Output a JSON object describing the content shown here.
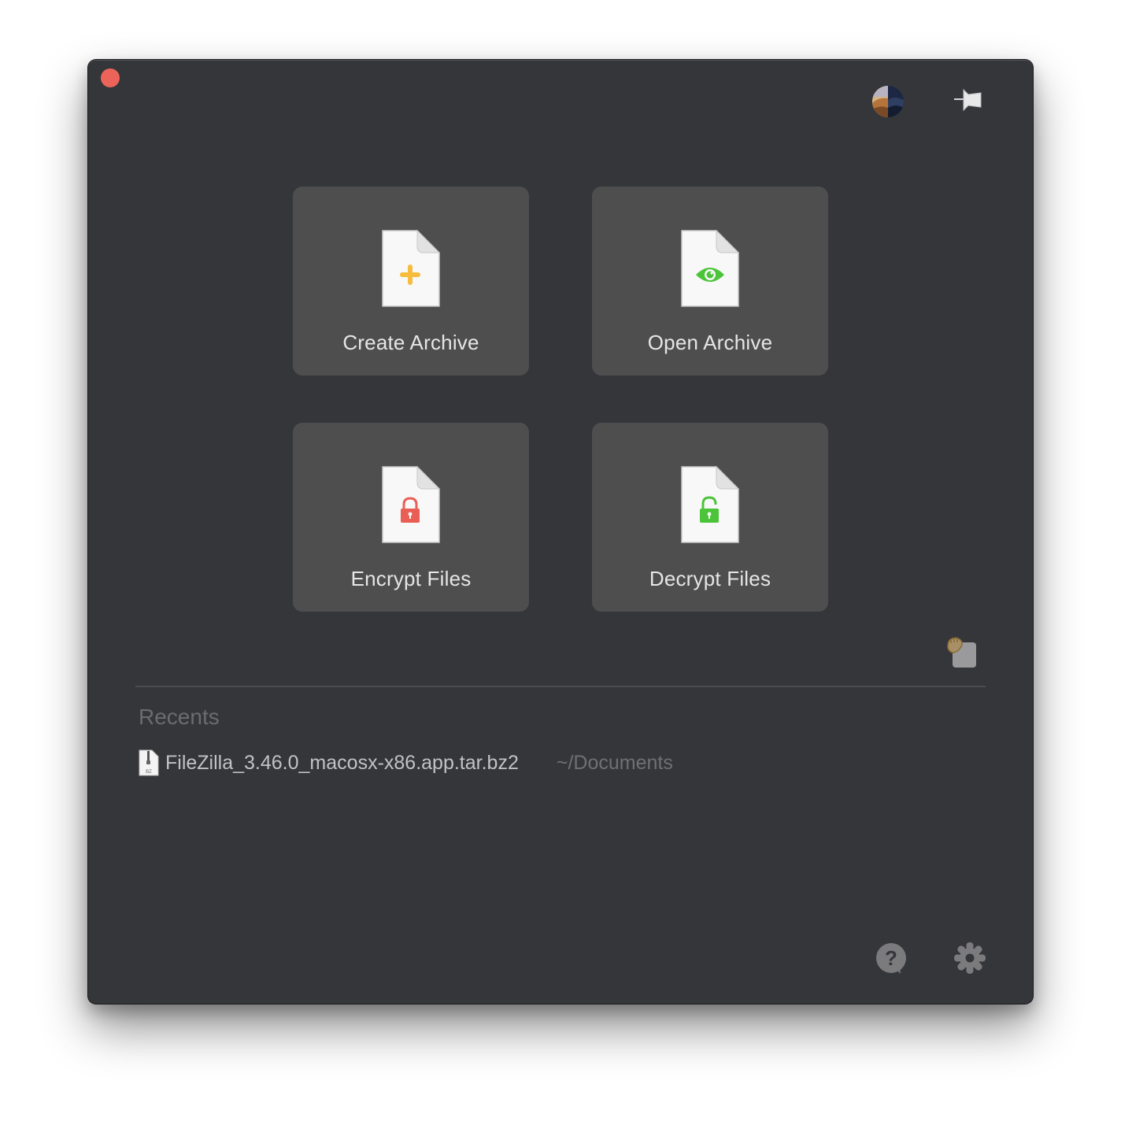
{
  "window": {
    "close_button": "close",
    "avatar": "user-avatar",
    "pin": "pin-window"
  },
  "actions": [
    {
      "label": "Create Archive",
      "icon": "plus-icon",
      "icon_color": "#f6bd3d"
    },
    {
      "label": "Open Archive",
      "icon": "eye-icon",
      "icon_color": "#4cc43a"
    },
    {
      "label": "Encrypt Files",
      "icon": "lock-closed-icon",
      "icon_color": "#ea5f55"
    },
    {
      "label": "Decrypt Files",
      "icon": "lock-open-icon",
      "icon_color": "#4cc43a"
    }
  ],
  "recents": {
    "title": "Recents",
    "items": [
      {
        "name": "FileZilla_3.46.0_macosx-x86.app.tar.bz2",
        "path": "~/Documents",
        "icon_badge": "BZ"
      }
    ]
  },
  "footer": {
    "help": "help",
    "settings": "settings"
  },
  "colors": {
    "window_bg": "#35363a",
    "tile_bg": "#4e4e4f",
    "close": "#ec6459"
  }
}
